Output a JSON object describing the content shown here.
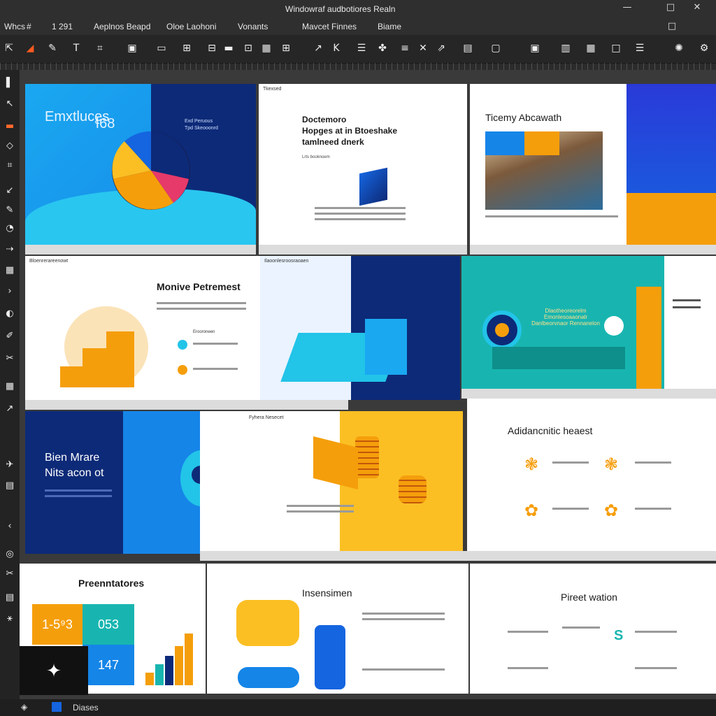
{
  "window": {
    "title": "Windowraf audbotiores Realn",
    "minimize": "—",
    "maximize": "□",
    "close": "✕"
  },
  "menu": [
    "Whcs",
    "#",
    "1 291",
    "Aeplnos Beapd",
    "Oloe Laohoni",
    "Vonants",
    "Mavcet Finnes",
    "Biame"
  ],
  "toolbar_icons": [
    "pointer-icon",
    "brush-icon",
    "pen-icon",
    "text-icon",
    "crop-icon",
    "image-icon",
    "shape-icon",
    "folder-icon",
    "layout-icon",
    "layers-icon",
    "frame-icon",
    "arrow-icon",
    "table-icon",
    "effects-icon",
    "grid-icon",
    "angle-icon",
    "export-icon",
    "clip-icon",
    "screen-icon",
    "gallery-icon",
    "page-icon",
    "slides-icon",
    "rect-icon",
    "list-icon",
    "settings-icon",
    "gear-icon"
  ],
  "slides": {
    "s1": {
      "title": "Emxtluces",
      "subtitle": "ɬ68",
      "caption_1": "Exd Peruous",
      "caption_2": "Tpd Skeooonrd"
    },
    "s2": {
      "header": "Tkexsed",
      "heading": "Doctemoro",
      "title_1": "Hopges at in Btoeshake",
      "title_2": "tamlneed dnerk",
      "tag": "Lrts booknoem"
    },
    "s3": {
      "title": "Ticemy Abcawath"
    },
    "s4": {
      "header": "Bloenrerareenowt",
      "title": "Monive Petremest",
      "item_label": "Erooroneen"
    },
    "s5": {
      "header": "Ilaoonlesroosraoaen"
    },
    "s6": {
      "caption": "Dlaotheoreorelm Emonlesoaaonalr Danlbeorvnaor Rennanelon"
    },
    "s7": {
      "title_1": "Bien Mrare",
      "title_2": "Nits acon ot",
      "label": "Fyhera Nesecet"
    },
    "s9": {
      "title": "Adidancnitic heaest"
    },
    "s10": {
      "title": "Preenntatores",
      "stat_1": "1-5⁹3",
      "stat_2": "053",
      "stat_3": "147"
    },
    "s11": {
      "title": "Insensimen"
    },
    "s12": {
      "title": "Pireet wation"
    }
  },
  "status": {
    "label": "Diases"
  },
  "colors": {
    "blue": "#1565e0",
    "navy": "#0d2a78",
    "cyan": "#22c4e8",
    "orange": "#f59e0b",
    "yellow": "#fbbf24",
    "teal": "#18b5b0"
  }
}
